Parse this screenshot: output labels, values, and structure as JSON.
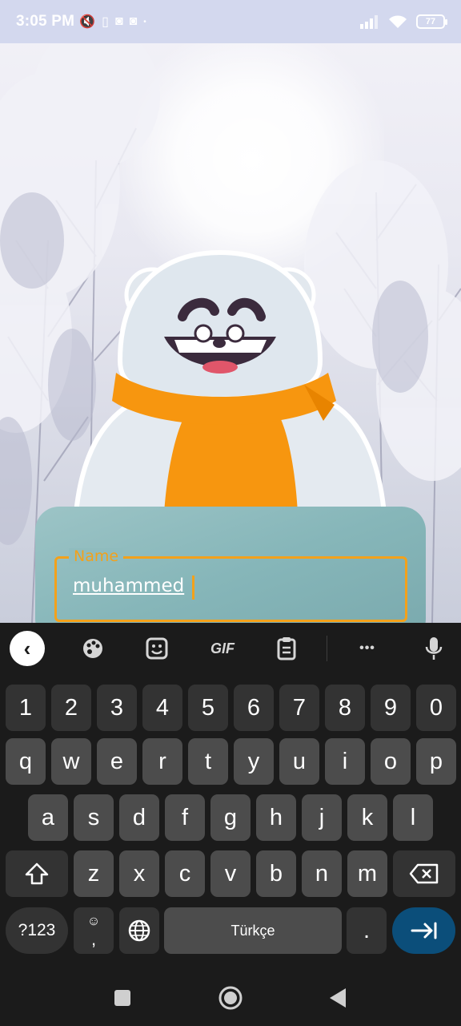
{
  "status_bar": {
    "time": "3:05 PM",
    "battery": "77",
    "icons": [
      "mute-icon",
      "sim-icon",
      "instagram-icon",
      "instagram-icon",
      "dot-icon",
      "signal-icon",
      "wifi-icon",
      "battery-icon"
    ]
  },
  "form": {
    "name_label": "Name",
    "name_value": "muhammed"
  },
  "keyboard": {
    "toolbar": [
      "back-icon",
      "palette-icon",
      "sticker-icon",
      "GIF",
      "clipboard-icon",
      "more-icon",
      "mic-icon"
    ],
    "gif_label": "GIF",
    "more_label": "•••",
    "row_numbers": [
      "1",
      "2",
      "3",
      "4",
      "5",
      "6",
      "7",
      "8",
      "9",
      "0"
    ],
    "row1": [
      "q",
      "w",
      "e",
      "r",
      "t",
      "y",
      "u",
      "i",
      "o",
      "p"
    ],
    "row2": [
      "a",
      "s",
      "d",
      "f",
      "g",
      "h",
      "j",
      "k",
      "l"
    ],
    "row3": [
      "z",
      "x",
      "c",
      "v",
      "b",
      "n",
      "m"
    ],
    "symbols_key": "?123",
    "comma_key": ",",
    "emoji_key": "☺",
    "space_label": "Türkçe",
    "period_key": "."
  },
  "colors": {
    "accent": "#f3a11b",
    "card": "#8fbcbe",
    "enter": "#0b4e7a",
    "status_bar": "#d3d8ee"
  }
}
